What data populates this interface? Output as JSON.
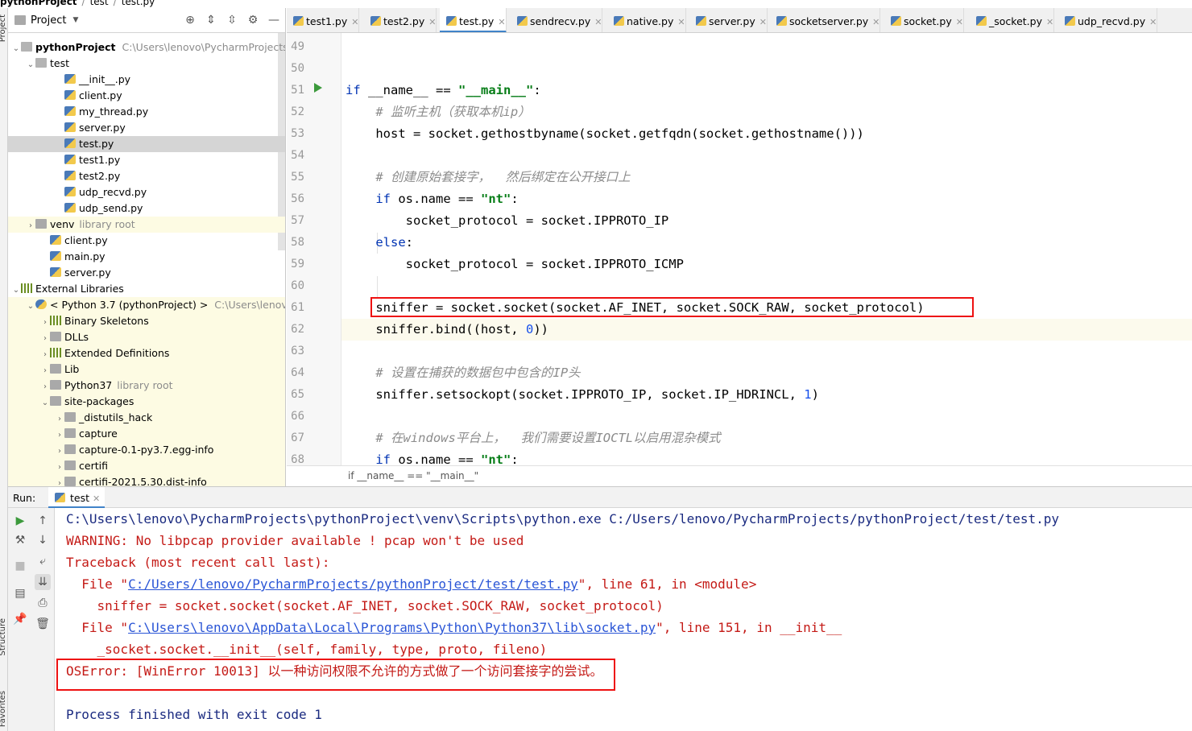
{
  "breadcrumb": [
    "pythonProject",
    "test",
    "test.py"
  ],
  "side_tabs": {
    "project": "Project",
    "structure": "Structure",
    "favorites": "Favorites"
  },
  "project_panel": {
    "title": "Project",
    "tree": [
      {
        "label": "pythonProject",
        "path": "C:\\Users\\lenovo\\PycharmProjects\\py",
        "type": "folder-open",
        "indent": 0,
        "arrow": "down",
        "bold": true
      },
      {
        "label": "test",
        "type": "folder-open",
        "indent": 1,
        "arrow": "down"
      },
      {
        "label": "__init__.py",
        "type": "py",
        "indent": 3
      },
      {
        "label": "client.py",
        "type": "py",
        "indent": 3
      },
      {
        "label": "my_thread.py",
        "type": "py",
        "indent": 3
      },
      {
        "label": "server.py",
        "type": "py",
        "indent": 3
      },
      {
        "label": "test.py",
        "type": "py",
        "indent": 3,
        "selected": true
      },
      {
        "label": "test1.py",
        "type": "py",
        "indent": 3
      },
      {
        "label": "test2.py",
        "type": "py",
        "indent": 3
      },
      {
        "label": "udp_recvd.py",
        "type": "py",
        "indent": 3
      },
      {
        "label": "udp_send.py",
        "type": "py",
        "indent": 3
      },
      {
        "label": "venv",
        "muted": "library root",
        "type": "folder",
        "indent": 1,
        "arrow": "right",
        "lib": true
      },
      {
        "label": "client.py",
        "type": "py",
        "indent": 2
      },
      {
        "label": "main.py",
        "type": "py",
        "indent": 2
      },
      {
        "label": "server.py",
        "type": "py",
        "indent": 2
      },
      {
        "label": "External Libraries",
        "type": "lib",
        "indent": 0,
        "arrow": "down"
      },
      {
        "label": "< Python 3.7 (pythonProject) >",
        "path": "C:\\Users\\lenovo\\",
        "type": "snake",
        "indent": 1,
        "arrow": "down",
        "lib": true
      },
      {
        "label": "Binary Skeletons",
        "type": "lib",
        "indent": 2,
        "arrow": "right",
        "lib": true
      },
      {
        "label": "DLLs",
        "type": "folder",
        "indent": 2,
        "arrow": "right",
        "lib": true
      },
      {
        "label": "Extended Definitions",
        "type": "lib",
        "indent": 2,
        "arrow": "right",
        "lib": true
      },
      {
        "label": "Lib",
        "type": "folder",
        "indent": 2,
        "arrow": "right",
        "lib": true
      },
      {
        "label": "Python37",
        "muted": "library root",
        "type": "folder",
        "indent": 2,
        "arrow": "right",
        "lib": true
      },
      {
        "label": "site-packages",
        "type": "folder",
        "indent": 2,
        "arrow": "down",
        "lib": true
      },
      {
        "label": "_distutils_hack",
        "type": "folder",
        "indent": 3,
        "arrow": "right",
        "lib": true
      },
      {
        "label": "capture",
        "type": "folder",
        "indent": 3,
        "arrow": "right",
        "lib": true
      },
      {
        "label": "capture-0.1-py3.7.egg-info",
        "type": "folder",
        "indent": 3,
        "arrow": "right",
        "lib": true
      },
      {
        "label": "certifi",
        "type": "folder",
        "indent": 3,
        "arrow": "right",
        "lib": true
      },
      {
        "label": "certifi-2021.5.30.dist-info",
        "type": "folder",
        "indent": 3,
        "arrow": "right",
        "lib": true
      }
    ]
  },
  "tabs": [
    {
      "label": "test1.py"
    },
    {
      "label": "test2.py"
    },
    {
      "label": "test.py",
      "active": true
    },
    {
      "label": "sendrecv.py"
    },
    {
      "label": "native.py"
    },
    {
      "label": "server.py"
    },
    {
      "label": "socketserver.py"
    },
    {
      "label": "socket.py"
    },
    {
      "label": "_socket.py"
    },
    {
      "label": "udp_recvd.py"
    }
  ],
  "editor": {
    "line_numbers": [
      "49",
      "50",
      "51",
      "52",
      "53",
      "54",
      "55",
      "56",
      "57",
      "58",
      "59",
      "60",
      "61",
      "62",
      "63",
      "64",
      "65",
      "66",
      "67",
      "68"
    ],
    "lines": [
      "",
      "",
      "if __name__ == \"__main__\":",
      "    # 监听主机（获取本机ip）",
      "    host = socket.gethostbyname(socket.getfqdn(socket.gethostname()))",
      "",
      "    # 创建原始套接字，  然后绑定在公开接口上",
      "    if os.name == \"nt\":",
      "        socket_protocol = socket.IPPROTO_IP",
      "    else:",
      "        socket_protocol = socket.IPPROTO_ICMP",
      "",
      "    sniffer = socket.socket(socket.AF_INET, socket.SOCK_RAW, socket_protocol)",
      "    sniffer.bind((host, 0))",
      "",
      "    # 设置在捕获的数据包中包含的IP头",
      "    sniffer.setsockopt(socket.IPPROTO_IP, socket.IP_HDRINCL, 1)",
      "",
      "    # 在windows平台上，  我们需要设置IOCTL以启用混杂模式",
      "    if os.name == \"nt\":"
    ],
    "status_crumb": "if __name__ == \"__main__\""
  },
  "run": {
    "label": "Run:",
    "tab": "test",
    "output": [
      {
        "text": "C:\\Users\\lenovo\\PycharmProjects\\pythonProject\\venv\\Scripts\\python.exe C:/Users/lenovo/PycharmProjects/pythonProject/test/test.py",
        "color": "blue"
      },
      {
        "text": "WARNING: No libpcap provider available ! pcap won't be used",
        "color": "red"
      },
      {
        "text": "Traceback (most recent call last):",
        "color": "red"
      },
      {
        "pre": "  File \"",
        "link": "C:/Users/lenovo/PycharmProjects/pythonProject/test/test.py",
        "post": "\", line 61, in <module>",
        "color": "red"
      },
      {
        "text": "    sniffer = socket.socket(socket.AF_INET, socket.SOCK_RAW, socket_protocol)",
        "color": "red"
      },
      {
        "pre": "  File \"",
        "link": "C:\\Users\\lenovo\\AppData\\Local\\Programs\\Python\\Python37\\lib\\socket.py",
        "post": "\", line 151, in __init__",
        "color": "red"
      },
      {
        "text": "    _socket.socket.__init__(self, family, type, proto, fileno)",
        "color": "red"
      },
      {
        "text": "OSError: [WinError 10013] 以一种访问权限不允许的方式做了一个访问套接字的尝试。",
        "color": "red"
      },
      {
        "text": "",
        "color": "blue"
      },
      {
        "text": "Process finished with exit code 1",
        "color": "blue"
      }
    ]
  }
}
